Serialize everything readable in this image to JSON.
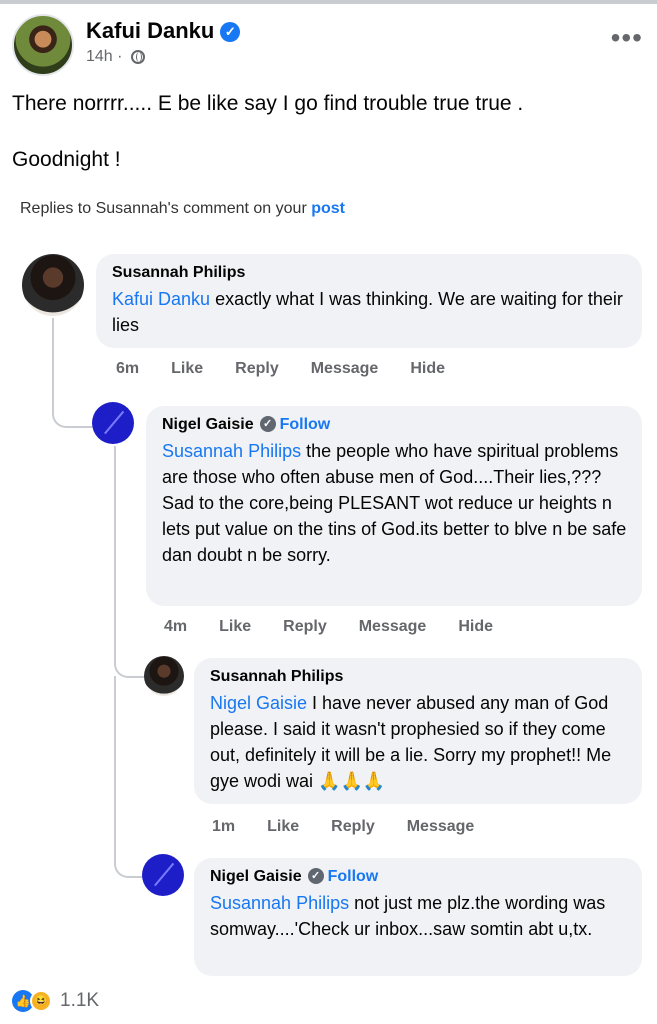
{
  "post": {
    "author": "Kafui Danku",
    "time": "14h",
    "separator": "·",
    "text_line1": "There norrrr..... E be like say I go find trouble true true .",
    "text_line2": "Goodnight !",
    "more_icon": "•••"
  },
  "replies_note": {
    "prefix": "Replies to Susannah's comment on your ",
    "link": "post"
  },
  "comments": [
    {
      "name": "Susannah Philips",
      "mention": "Kafui Danku",
      "text": " exactly what I was thinking. We are waiting for their lies",
      "time": "6m",
      "actions": [
        "Like",
        "Reply",
        "Message",
        "Hide"
      ]
    },
    {
      "name": "Nigel Gaisie",
      "follow": "Follow",
      "mention": "Susannah Philips",
      "text": " the people who have spiritual problems are those who often abuse men of God....Their lies,???Sad to the core,being PLESANT wot reduce ur heights n lets put value on the tins of God.its better to blve n be safe dan doubt n be sorry.",
      "time": "4m",
      "actions": [
        "Like",
        "Reply",
        "Message",
        "Hide"
      ]
    },
    {
      "name": "Susannah Philips",
      "mention": "Nigel Gaisie",
      "text": " I have never abused any man of God please. I said it wasn't prophesied so if they come out, definitely it will be a lie. Sorry my prophet!! Me gye wodi wai 🙏🙏🙏",
      "time": "1m",
      "actions": [
        "Like",
        "Reply",
        "Message"
      ]
    },
    {
      "name": "Nigel Gaisie",
      "follow": "Follow",
      "mention": "Susannah Philips",
      "text": " not just me plz.the wording was somway....'Check ur inbox...saw somtin abt u,tx."
    }
  ],
  "reactions": {
    "count": "1.1K",
    "like_icon": "👍",
    "haha_icon": "😆"
  },
  "icons": {
    "verified": "✓"
  }
}
